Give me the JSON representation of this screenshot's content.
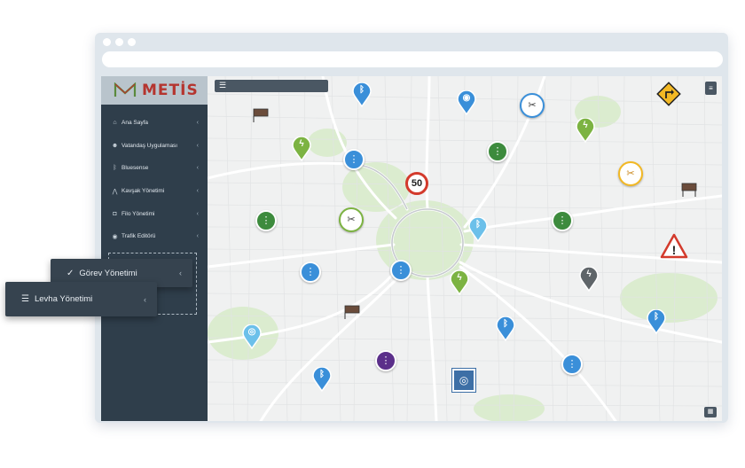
{
  "app": {
    "logo_text": "METİS"
  },
  "sidebar": {
    "items": [
      {
        "label": "Ana Sayfa",
        "icon": "home-icon",
        "glyph": "⌂"
      },
      {
        "label": "Vatandaş Uygulaması",
        "icon": "users-icon",
        "glyph": "☻"
      },
      {
        "label": "Bluesense",
        "icon": "bluetooth-icon",
        "glyph": "ᛒ"
      },
      {
        "label": "Kavşak Yönetimi",
        "icon": "road-icon",
        "glyph": "⋀"
      },
      {
        "label": "Filo Yönetimi",
        "icon": "car-icon",
        "glyph": "◘"
      },
      {
        "label": "Trafik Editörü",
        "icon": "traffic-editor-icon",
        "glyph": "◉"
      }
    ],
    "chevron": "‹"
  },
  "popups": {
    "gorev": {
      "label": "Görev Yönetimi",
      "glyph": "✓",
      "chevron": "‹"
    },
    "levha": {
      "label": "Levha Yönetimi",
      "glyph": "☰",
      "chevron": "‹"
    }
  },
  "map": {
    "menu_glyph": "☰",
    "layers_glyph": "≡",
    "corner_glyph": "▦",
    "speed_sign": "50",
    "markers": {
      "bluetooth_glyph": "ᛒ",
      "bolt_glyph": "ϟ",
      "traffic_light_glyph": "⋮",
      "eye_glyph": "◉",
      "camera_glyph": "◎",
      "warning_glyph": "!",
      "tools_glyph": "✂"
    }
  },
  "colors": {
    "sidebar_bg": "#2f3e4b",
    "blue_marker": "#3a8fd9",
    "light_blue_marker": "#6cc0ea",
    "green_marker": "#7cb342",
    "dark_green_marker": "#3d8b3d",
    "purple_marker": "#5b2f8a",
    "gray_marker": "#5f6569",
    "warning_red": "#d33a2c",
    "sign_yellow": "#f2b824",
    "logo_red": "#b5352f"
  }
}
